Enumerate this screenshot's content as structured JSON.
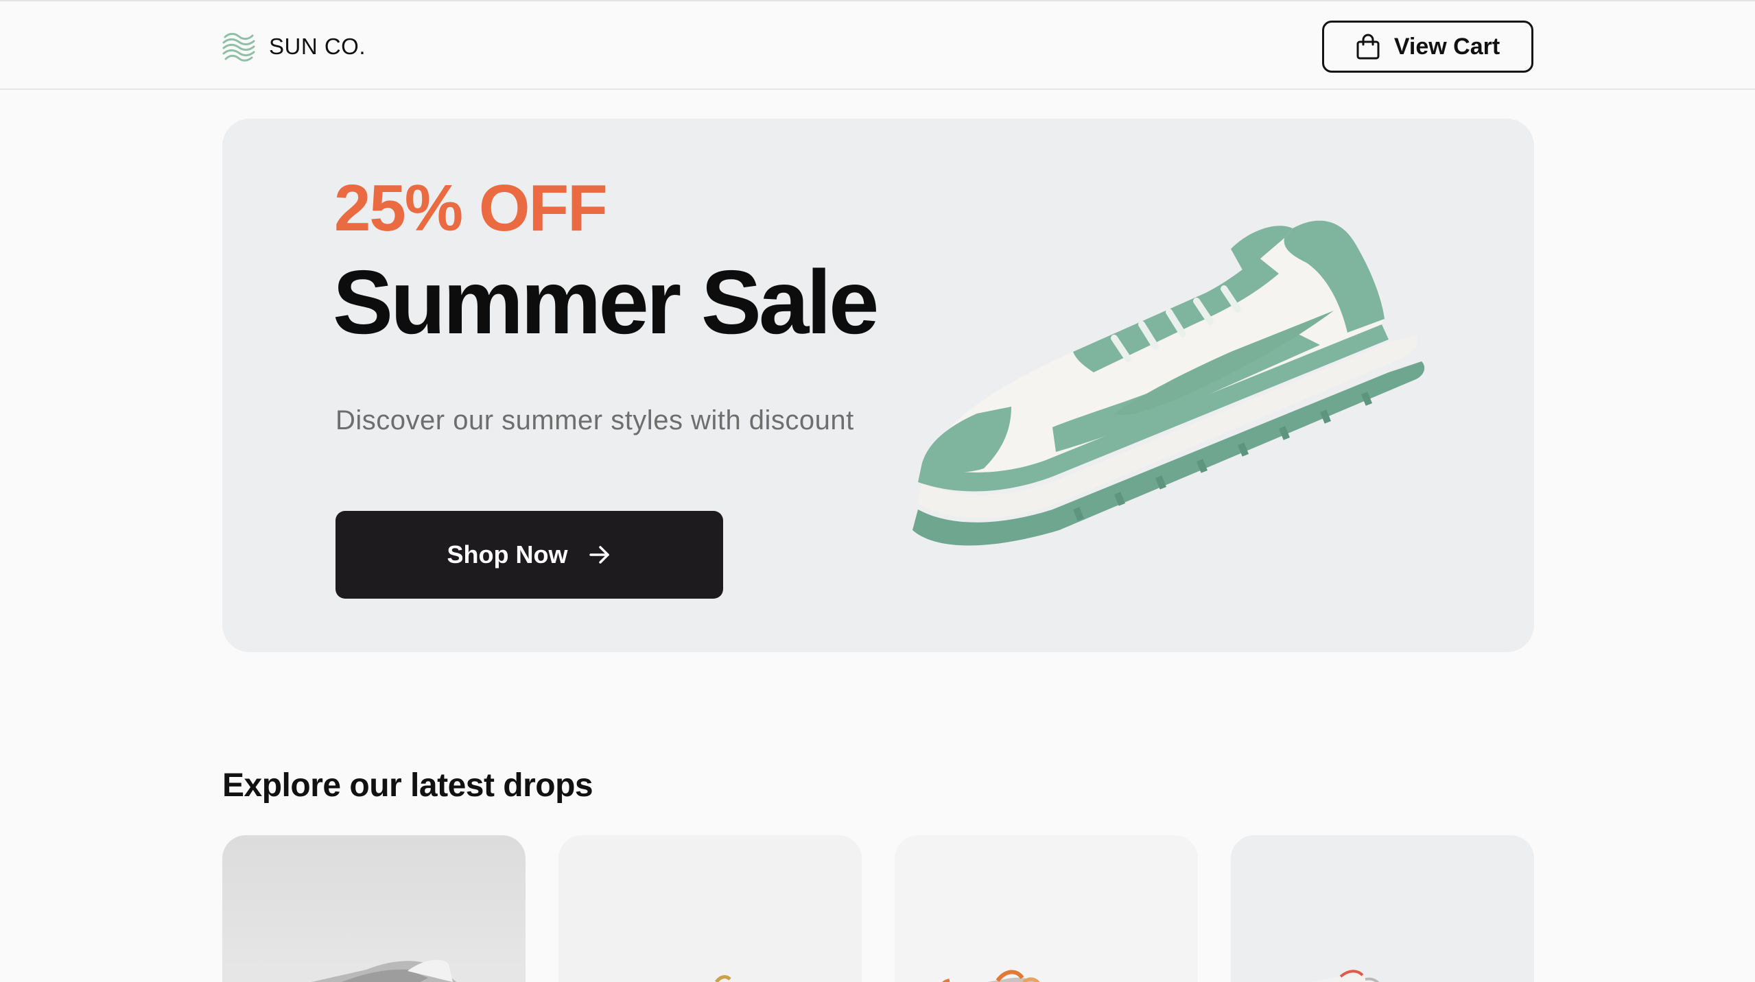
{
  "header": {
    "brand_name": "SUN CO.",
    "brand_icon": "waves-logo-icon",
    "cart_label": "View Cart",
    "cart_icon": "shopping-bag-icon"
  },
  "hero": {
    "discount": "25% OFF",
    "title": "Summer Sale",
    "subtitle": "Discover our summer styles with discount",
    "cta_label": "Shop Now",
    "cta_icon": "arrow-right-icon",
    "image": "green-white-sneaker"
  },
  "drops": {
    "title": "Explore our latest drops",
    "products": [
      {
        "image": "grey-sneaker"
      },
      {
        "image": "white-gold-sneaker"
      },
      {
        "image": "orange-sneaker"
      },
      {
        "image": "white-red-sneaker"
      }
    ]
  },
  "colors": {
    "accent": "#ea6a42",
    "button_dark": "#1e1b1f",
    "hero_bg": "#eceeef",
    "sneaker_green": "#7fb59e"
  }
}
